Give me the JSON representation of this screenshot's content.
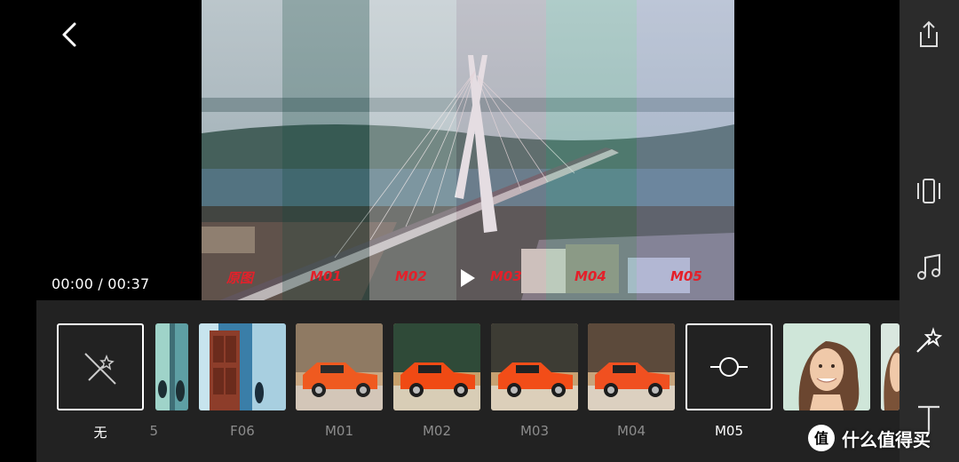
{
  "player": {
    "time": "00:00 / 00:37",
    "compare_labels": [
      "原图",
      "M01",
      "M02",
      "M03",
      "M04",
      "M05"
    ]
  },
  "filters": [
    {
      "name": "无",
      "kind": "none"
    },
    {
      "name": "5",
      "kind": "partial"
    },
    {
      "name": "F06",
      "kind": "door"
    },
    {
      "name": "M01",
      "kind": "car"
    },
    {
      "name": "M02",
      "kind": "car"
    },
    {
      "name": "M03",
      "kind": "car"
    },
    {
      "name": "M04",
      "kind": "car"
    },
    {
      "name": "M05",
      "kind": "selected-adjust"
    },
    {
      "name": "",
      "kind": "portrait"
    },
    {
      "name": "",
      "kind": "portrait-partial"
    }
  ],
  "toolbar": [
    "share-icon",
    "aspect-ratio-icon",
    "music-icon",
    "magic-wand-filter-icon",
    "text-icon"
  ],
  "watermark": {
    "text": "什么值得买",
    "icon_glyph": "值"
  },
  "colors": {
    "accent_red": "#e4202a",
    "panel_bg": "#222222",
    "sidebar_bg": "#2b2b2b"
  }
}
